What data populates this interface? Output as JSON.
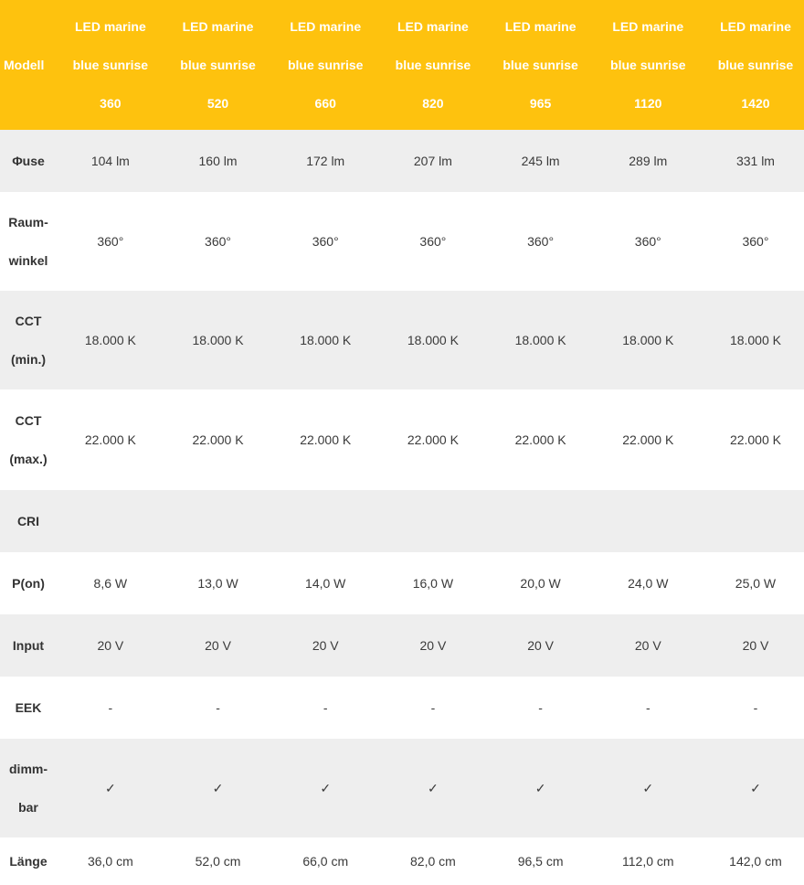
{
  "table": {
    "corner_label": "Modell",
    "columns": [
      {
        "line1": "LED marine",
        "line2": "blue sunrise",
        "line3": "360"
      },
      {
        "line1": "LED marine",
        "line2": "blue sunrise",
        "line3": "520"
      },
      {
        "line1": "LED marine",
        "line2": "blue sunrise",
        "line3": "660"
      },
      {
        "line1": "LED marine",
        "line2": "blue sunrise",
        "line3": "820"
      },
      {
        "line1": "LED marine",
        "line2": "blue sunrise",
        "line3": "965"
      },
      {
        "line1": "LED marine",
        "line2": "blue sunrise",
        "line3": "1120"
      },
      {
        "line1": "LED marine",
        "line2": "blue sunrise",
        "line3": "1420"
      }
    ],
    "rows": [
      {
        "label1": "Φuse",
        "label2": "",
        "values": [
          "104 lm",
          "160 lm",
          "172 lm",
          "207 lm",
          "245 lm",
          "289 lm",
          "331 lm"
        ]
      },
      {
        "label1": "Raum-",
        "label2": "winkel",
        "values": [
          "360°",
          "360°",
          "360°",
          "360°",
          "360°",
          "360°",
          "360°"
        ]
      },
      {
        "label1": "CCT",
        "label2": "(min.)",
        "values": [
          "18.000 K",
          "18.000 K",
          "18.000 K",
          "18.000 K",
          "18.000 K",
          "18.000 K",
          "18.000 K"
        ]
      },
      {
        "label1": "CCT",
        "label2": "(max.)",
        "values": [
          "22.000 K",
          "22.000 K",
          "22.000 K",
          "22.000 K",
          "22.000 K",
          "22.000 K",
          "22.000 K"
        ]
      },
      {
        "label1": "CRI",
        "label2": "",
        "values": [
          "",
          "",
          "",
          "",
          "",
          "",
          ""
        ]
      },
      {
        "label1": "P(on)",
        "label2": "",
        "values": [
          "8,6 W",
          "13,0 W",
          "14,0 W",
          "16,0 W",
          "20,0 W",
          "24,0 W",
          "25,0 W"
        ]
      },
      {
        "label1": "Input",
        "label2": "",
        "values": [
          "20 V",
          "20 V",
          "20 V",
          "20 V",
          "20 V",
          "20 V",
          "20 V"
        ]
      },
      {
        "label1": "EEK",
        "label2": "",
        "values": [
          "-",
          "-",
          "-",
          "-",
          "-",
          "-",
          "-"
        ]
      },
      {
        "label1": "dimm-",
        "label2": "bar",
        "values": [
          "✓",
          "✓",
          "✓",
          "✓",
          "✓",
          "✓",
          "✓"
        ]
      },
      {
        "label1": "Länge",
        "label2": "",
        "values": [
          "36,0 cm",
          "52,0 cm",
          "66,0 cm",
          "82,0 cm",
          "96,5 cm",
          "112,0 cm",
          "142,0 cm"
        ]
      }
    ]
  },
  "colors": {
    "header_bg": "#fec20e",
    "header_text": "#ffffff",
    "stripe_bg": "#eeeeee",
    "body_text": "#333333"
  }
}
